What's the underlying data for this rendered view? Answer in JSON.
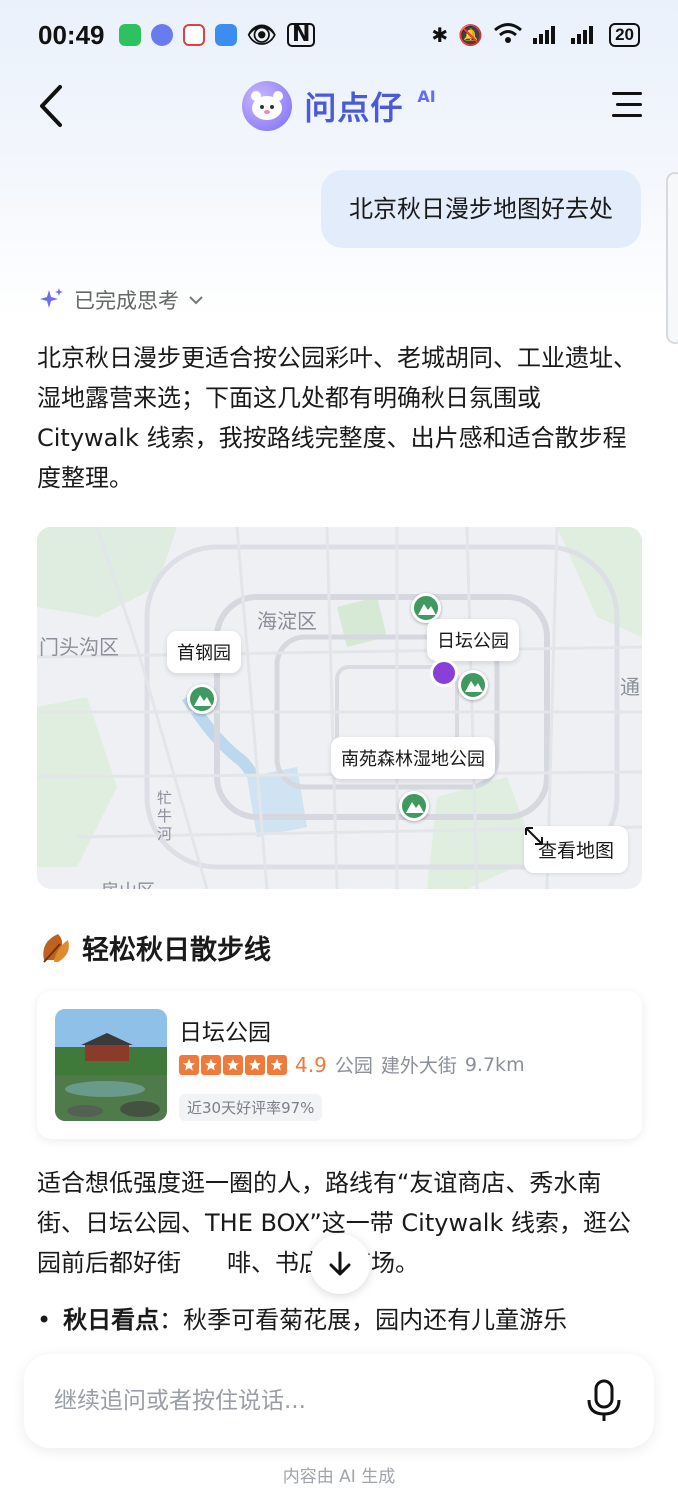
{
  "status": {
    "time": "00:49",
    "battery": "20"
  },
  "header": {
    "title": "问点仔",
    "title_badge": "AI"
  },
  "user_message": "北京秋日漫步地图好去处",
  "thinking_label": "已完成思考",
  "answer_intro": "北京秋日漫步更适合按公园彩叶、老城胡同、工业遗址、湿地露营来选；下面这几处都有明确秋日氛围或 Citywalk 线索，我按路线完整度、出片感和适合散步程度整理。",
  "map": {
    "areas": [
      "海淀区",
      "门头沟区",
      "通",
      "牤牛河",
      "房山区"
    ],
    "pins": [
      "首钢园",
      "日坛公园",
      "南苑森林湿地公园"
    ],
    "view_map_label": "查看地图"
  },
  "section": {
    "title": "轻松秋日散步线",
    "icon": "autumn-leaf-icon"
  },
  "poi": {
    "name": "日坛公园",
    "rating": "4.9",
    "category": "公园",
    "location": "建外大街",
    "distance": "9.7km",
    "tag": "近30天好评率97%"
  },
  "detail_text": "适合想低强度逛一圈的人，路线有“友谊商店、秀水南街、日坛公园、THE BOX”这一带 Citywalk 线索，逛公园前后都好街",
  "detail_text_tail": "啡、书店或商场。",
  "bullet": {
    "label": "秋日看点",
    "text": "：秋季可看菊花展，园内还有儿童游乐"
  },
  "input": {
    "placeholder": "继续追问或者按住说话..."
  },
  "footer_note": "内容由 AI 生成"
}
